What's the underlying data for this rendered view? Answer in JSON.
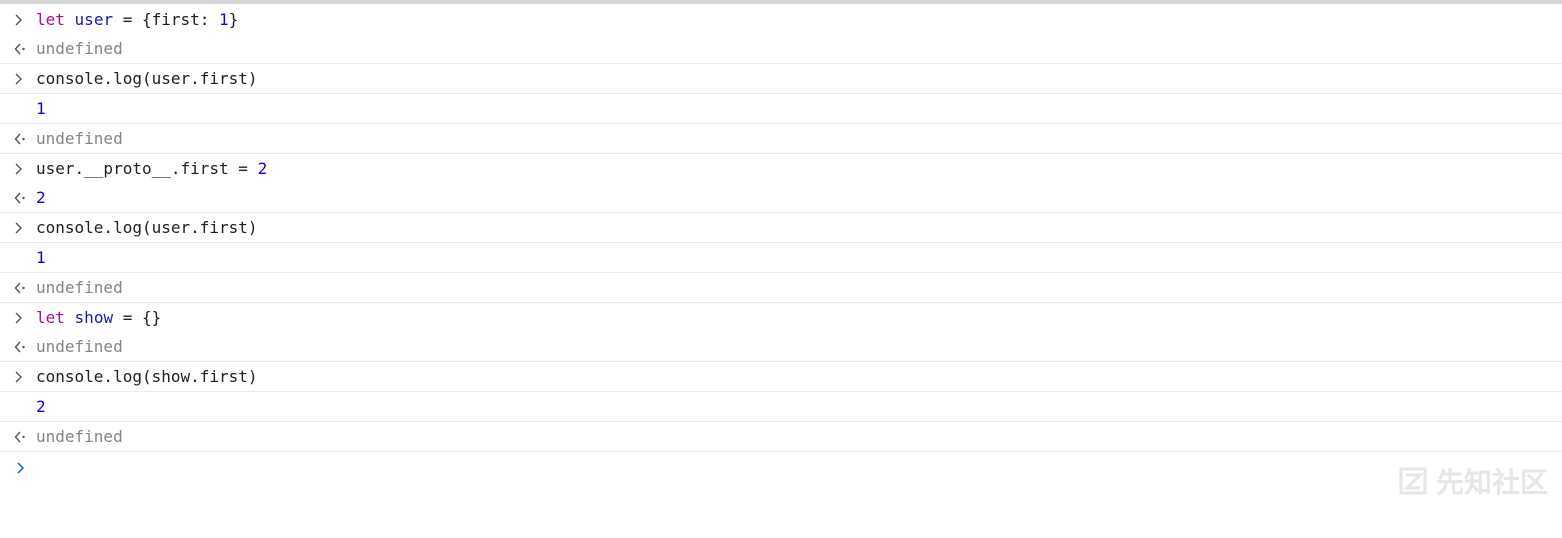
{
  "console": {
    "entries": [
      {
        "input": [
          "let",
          " ",
          "user",
          " = {first: ",
          "1",
          "}"
        ],
        "outputs": [
          {
            "kind": "return",
            "text": "undefined"
          }
        ]
      },
      {
        "input": [
          "console.log(user.first)"
        ],
        "outputs": [
          {
            "kind": "log",
            "text": "1"
          },
          {
            "kind": "return",
            "text": "undefined"
          }
        ]
      },
      {
        "input": [
          "user.__proto__.first = ",
          "2"
        ],
        "outputs": [
          {
            "kind": "return",
            "text": "2"
          }
        ]
      },
      {
        "input": [
          "console.log(user.first)"
        ],
        "outputs": [
          {
            "kind": "log",
            "text": "1"
          },
          {
            "kind": "return",
            "text": "undefined"
          }
        ]
      },
      {
        "input": [
          "let",
          " ",
          "show",
          " = {}"
        ],
        "outputs": [
          {
            "kind": "return",
            "text": "undefined"
          }
        ]
      },
      {
        "input": [
          "console.log(show.first)"
        ],
        "outputs": [
          {
            "kind": "log",
            "text": "2"
          },
          {
            "kind": "return",
            "text": "undefined"
          }
        ]
      }
    ],
    "prompt_icon": "chevron-right-icon",
    "input_icon": "chevron-right-icon",
    "return_icon": "return-arrow-icon"
  },
  "watermark": {
    "text": "先知社区",
    "icon": "logo-icon"
  },
  "colors": {
    "keyword": "#aa0d91",
    "variable": "#1a1aa6",
    "number": "#1c00cf",
    "undefined": "#80868b",
    "prompt": "#1a73e8"
  }
}
